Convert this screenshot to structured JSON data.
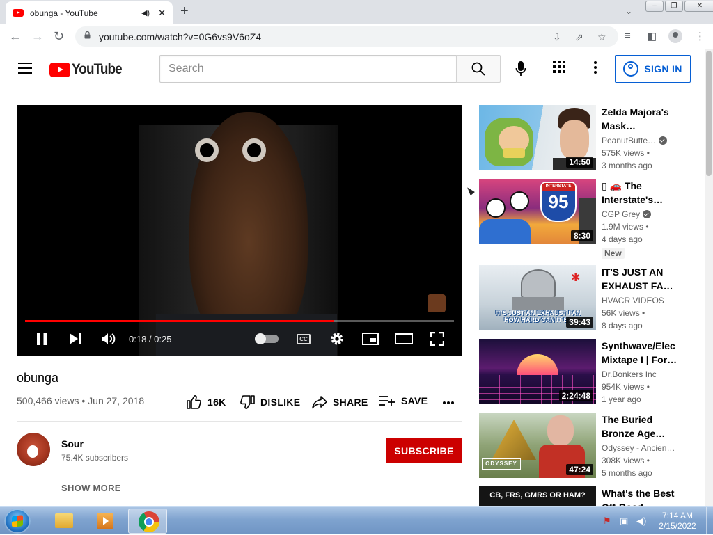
{
  "browser": {
    "tab_title": "obunga - YouTube",
    "url": "youtube.com/watch?v=0G6vs9V6oZ4",
    "new_tab": "+",
    "close_tab": "✕"
  },
  "header": {
    "logo_text": "YouTube",
    "search_placeholder": "Search",
    "signin_label": "SIGN IN"
  },
  "player": {
    "time": "0:18 / 0:25",
    "cc_label": "CC",
    "played_fraction": 0.72,
    "loaded_fraction": 0.72
  },
  "video": {
    "title": "obunga",
    "meta": "500,466 views • Jun 27, 2018",
    "like_count": "16K",
    "dislike_label": "DISLIKE",
    "share_label": "SHARE",
    "save_label": "SAVE"
  },
  "channel": {
    "name": "Sour",
    "subscribers": "75.4K subscribers",
    "subscribe_label": "SUBSCRIBE",
    "show_more": "SHOW MORE"
  },
  "related": [
    {
      "title": "Zelda Majora's Mask…",
      "channel": "PeanutButte…",
      "verified": true,
      "views": "575K views •",
      "age": "3 months ago",
      "duration": "14:50",
      "badge": ""
    },
    {
      "title": "▯ 🚗 The Interstate's…",
      "channel": "CGP Grey",
      "verified": true,
      "views": "1.9M views •",
      "age": "4 days ago",
      "duration": "8:30",
      "badge": "New"
    },
    {
      "title": "IT'S JUST AN EXHAUST FA…",
      "channel": "HVACR VIDEOS",
      "verified": false,
      "views": "56K views •",
      "age": "8 days ago",
      "duration": "39:43",
      "badge": ""
    },
    {
      "title": "Synthwave/Elec Mixtape I | For…",
      "channel": "Dr.Bonkers Inc",
      "verified": false,
      "views": "954K views •",
      "age": "1 year ago",
      "duration": "2:24:48",
      "badge": ""
    },
    {
      "title": "The Buried Bronze Age…",
      "channel": "Odyssey - Ancien…",
      "verified": false,
      "views": "308K views •",
      "age": "5 months ago",
      "duration": "47:24",
      "badge": ""
    },
    {
      "title": "What's the Best Off-Road…",
      "channel": "",
      "verified": false,
      "views": "",
      "age": "",
      "duration": "",
      "badge": ""
    }
  ],
  "thumb_text": {
    "interstate": "INTERSTATE",
    "route": "95",
    "exhaust": "IT'S JUST AN EXHAUST FAN HOW HARD CAN IT BE",
    "odyssey": "ODYSSEY",
    "offroad": "CB, FRS, GMRS OR HAM?"
  },
  "taskbar": {
    "time": "7:14 AM",
    "date": "2/15/2022"
  }
}
